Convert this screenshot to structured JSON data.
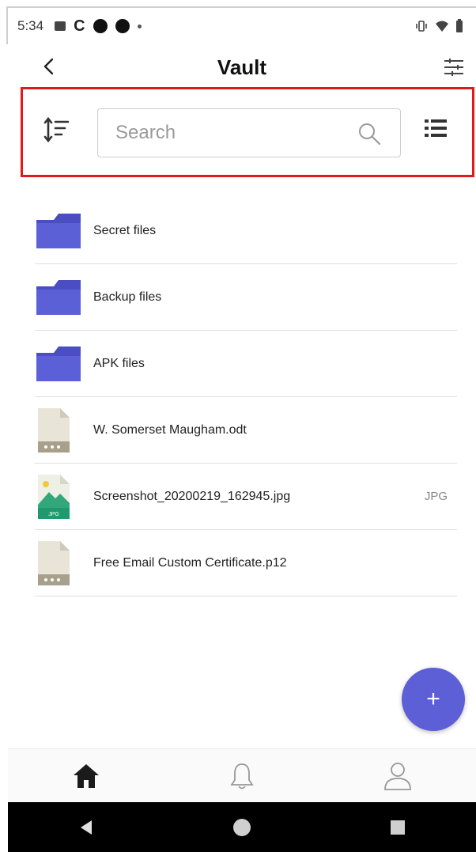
{
  "status_bar": {
    "time": "5:34"
  },
  "header": {
    "title": "Vault",
    "back_icon": "back-arrow-icon",
    "filter_icon": "filter-sliders-icon"
  },
  "toolbar": {
    "sort_icon": "sort-icon",
    "search": {
      "placeholder": "Search",
      "value": ""
    },
    "view_icon": "list-view-icon"
  },
  "files": [
    {
      "name": "Secret files",
      "type": "folder",
      "badge": ""
    },
    {
      "name": "Backup files",
      "type": "folder",
      "badge": ""
    },
    {
      "name": "APK files",
      "type": "folder",
      "badge": ""
    },
    {
      "name": "W. Somerset Maugham.odt",
      "type": "document",
      "badge": ""
    },
    {
      "name": "Screenshot_20200219_162945.jpg",
      "type": "image",
      "badge": "JPG"
    },
    {
      "name": "Free Email Custom Certificate.p12",
      "type": "document",
      "badge": ""
    }
  ],
  "fab": {
    "label": "+"
  },
  "bottom_nav": [
    {
      "icon": "home-icon"
    },
    {
      "icon": "bell-icon"
    },
    {
      "icon": "user-icon"
    }
  ],
  "colors": {
    "accent": "#5c5fd6",
    "folder": "#5257c9",
    "highlight": "#e01a1a"
  }
}
